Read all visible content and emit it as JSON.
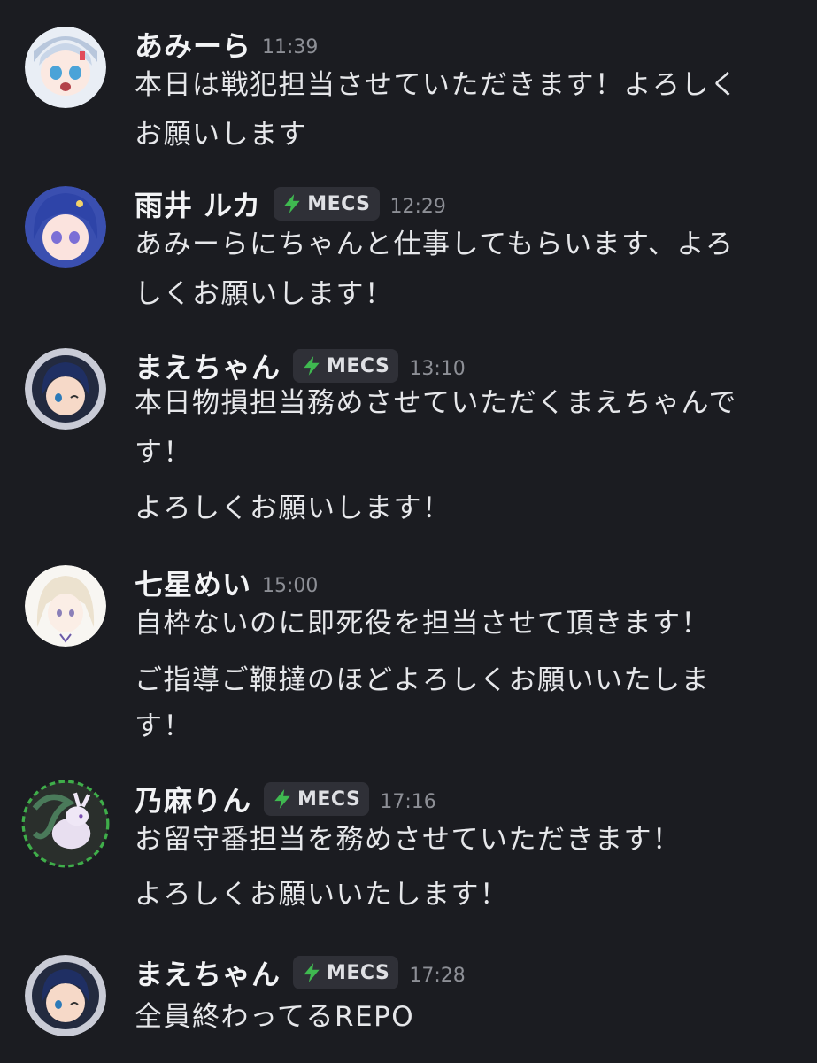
{
  "messages": [
    {
      "author": "あみーら",
      "time": "11:39",
      "tag": "",
      "lines": [
        "本日は戦犯担当させていただきます！よろしく",
        "お願いします"
      ]
    },
    {
      "author": "雨井 ルカ",
      "time": "12:29",
      "tag": "MECS",
      "lines": [
        "あみーらにちゃんと仕事してもらいます、よろ",
        "しくお願いします！"
      ]
    },
    {
      "author": "まえちゃん",
      "time": "13:10",
      "tag": "MECS",
      "lines": [
        "本日物損担当務めさせていただくまえちゃんで",
        "す！",
        "よろしくお願いします！"
      ]
    },
    {
      "author": "七星めい",
      "time": "15:00",
      "tag": "",
      "lines": [
        "自枠ないのに即死役を担当させて頂きます！",
        "ご指導ご鞭撻のほどよろしくお願いいたしま",
        "す！"
      ]
    },
    {
      "author": "乃麻りん",
      "time": "17:16",
      "tag": "MECS",
      "lines": [
        "お留守番担当を務めさせていただきます！",
        "よろしくお願いいたします！"
      ]
    },
    {
      "author": "まえちゃん",
      "time": "17:28",
      "tag": "MECS",
      "lines": [
        "全員終わってるREPO"
      ]
    }
  ],
  "icons": {
    "tag_icon": "lightning-bolt-icon",
    "tag_icon_color": "#3fb950"
  }
}
